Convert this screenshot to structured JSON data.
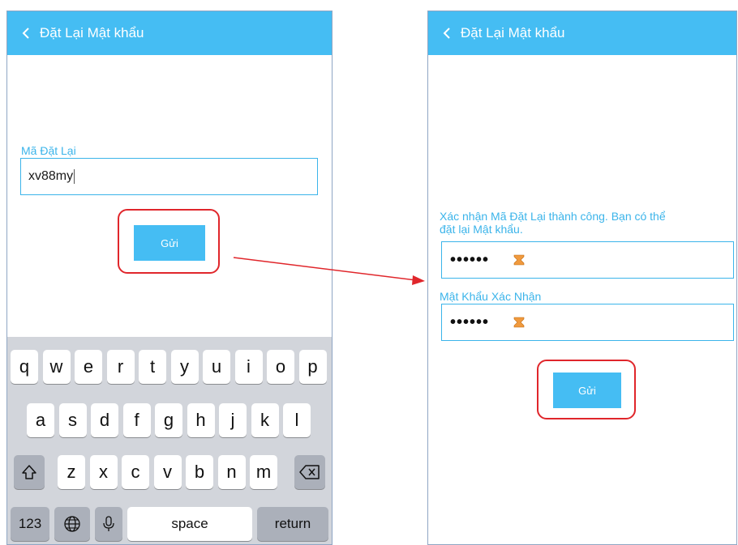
{
  "left_screen": {
    "title": "Đặt Lại Mật khẩu",
    "field_label": "Mã Đặt Lại",
    "field_value": "xv88my",
    "submit_label": "Gửi"
  },
  "right_screen": {
    "title": "Đặt Lại Mật khẩu",
    "message_line1": "Xác nhận Mã Đặt Lại thành công. Bạn có thể",
    "message_line2": "đặt lại Mật khẩu.",
    "password_value": "••••••",
    "confirm_label": "Mật Khẩu Xác Nhận",
    "confirm_value": "••••••",
    "submit_label": "Gửi"
  },
  "keyboard": {
    "row1": [
      "q",
      "w",
      "e",
      "r",
      "t",
      "y",
      "u",
      "i",
      "o",
      "p"
    ],
    "row2": [
      "a",
      "s",
      "d",
      "f",
      "g",
      "h",
      "j",
      "k",
      "l"
    ],
    "row3": [
      "z",
      "x",
      "c",
      "v",
      "b",
      "n",
      "m"
    ],
    "numbers_label": "123",
    "space_label": "space",
    "return_label": "return"
  },
  "colors": {
    "accent": "#45bdf3",
    "highlight": "#e0262b"
  }
}
